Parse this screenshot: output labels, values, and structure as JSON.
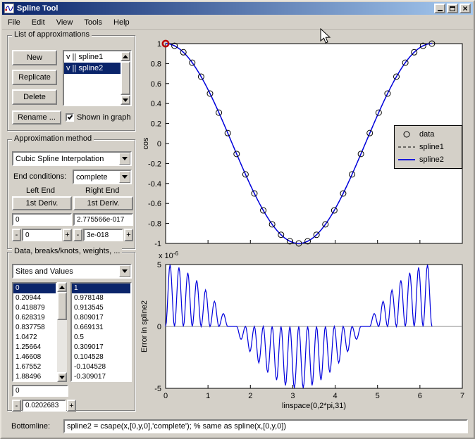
{
  "window": {
    "title": "Spline Tool",
    "controls": {
      "minimize": "minimize",
      "maximize": "maximize",
      "close_glyph": "×"
    }
  },
  "menu": [
    "File",
    "Edit",
    "View",
    "Tools",
    "Help"
  ],
  "ui": {
    "minus": "-",
    "plus": "+"
  },
  "approx_list": {
    "title": "List of approximations",
    "buttons": [
      "New",
      "Replicate",
      "Delete",
      "Rename ..."
    ],
    "items": [
      {
        "label": "v || spline1",
        "selected": false
      },
      {
        "label": "v || spline2",
        "selected": true
      }
    ],
    "checkbox_label": "Shown in graph",
    "checkbox_checked": true
  },
  "method": {
    "title": "Approximation method",
    "method_select": "Cubic Spline Interpolation",
    "end_conditions_label": "End conditions:",
    "end_conditions_value": "complete",
    "left_end_label": "Left End",
    "right_end_label": "Right End",
    "left_button": "1st Deriv.",
    "right_button": "1st Deriv.",
    "left_value": "0",
    "right_value": "2.775566e-017",
    "left_spinner_value": "0",
    "right_spinner_value": "3e-018"
  },
  "data_panel": {
    "title": "Data, breaks/knots, weights, ...",
    "select_value": "Sites and Values",
    "sites": [
      "0",
      "0.20944",
      "0.418879",
      "0.628319",
      "0.837758",
      "1.0472",
      "1.25664",
      "1.46608",
      "1.67552",
      "1.88496"
    ],
    "values": [
      "1",
      "0.978148",
      "0.913545",
      "0.809017",
      "0.669131",
      "0.5",
      "0.309017",
      "0.104528",
      "-0.104528",
      "-0.309017"
    ],
    "edit_value": "0",
    "spinner_value": "0.0202683"
  },
  "bottomline": {
    "label": "Bottomline:",
    "value": "spline2 = csape(x,[0,y,0],'complete'); % same as  spline(x,[0,y,0])"
  },
  "chart_data": [
    {
      "type": "line",
      "title": "",
      "xlabel": "",
      "ylabel": "cos",
      "xlim": [
        0,
        7
      ],
      "ylim": [
        -1,
        1
      ],
      "xticks": [
        0,
        1,
        2,
        3,
        4,
        5,
        6,
        7
      ],
      "yticks": [
        -1,
        -0.8,
        -0.6,
        -0.4,
        -0.2,
        0,
        0.2,
        0.4,
        0.6,
        0.8,
        1
      ],
      "grid": false,
      "legend": [
        "data",
        "spline1",
        "spline2"
      ],
      "legend_position": "right-center",
      "x": [
        0,
        0.20944,
        0.41888,
        0.62832,
        0.83776,
        1.0472,
        1.25664,
        1.46608,
        1.67552,
        1.88496,
        2.0944,
        2.30383,
        2.51327,
        2.72271,
        2.93215,
        3.14159,
        3.35103,
        3.56047,
        3.76991,
        3.97935,
        4.18879,
        4.39823,
        4.60767,
        4.81711,
        5.02655,
        5.23599,
        5.44543,
        5.65487,
        5.86431,
        6.07375,
        6.28319
      ],
      "series": [
        {
          "name": "data",
          "style": "scatter-circle",
          "color": "#000000",
          "values": [
            1,
            0.978148,
            0.913545,
            0.809017,
            0.669131,
            0.5,
            0.309017,
            0.104528,
            -0.104528,
            -0.309017,
            -0.5,
            -0.669131,
            -0.809017,
            -0.913545,
            -0.978148,
            -1,
            -0.978148,
            -0.913545,
            -0.809017,
            -0.669131,
            -0.5,
            -0.309017,
            -0.104528,
            0.104528,
            0.309017,
            0.5,
            0.669131,
            0.809017,
            0.913545,
            0.978148,
            1
          ]
        },
        {
          "name": "spline1",
          "style": "dashed",
          "color": "#000000",
          "note": "cubic spline through data, visually coincides with cos"
        },
        {
          "name": "spline2",
          "style": "solid",
          "color": "#0000dd",
          "note": "cubic spline through data, visually coincides with cos"
        }
      ],
      "highlight_point": {
        "index": 0,
        "color": "#bb0000"
      }
    },
    {
      "type": "line",
      "title": "",
      "xlabel": "linspace(0,2*pi,31)",
      "ylabel": "Error in spline2",
      "scale_label": "x 10^-6",
      "unit": 1e-06,
      "xlim": [
        0,
        7
      ],
      "ylim": [
        -5,
        5
      ],
      "xticks": [
        0,
        1,
        2,
        3,
        4,
        5,
        6,
        7
      ],
      "yticks": [
        -5,
        0,
        5
      ],
      "grid": false,
      "zero_line": true,
      "color": "#0000dd",
      "knots_x": [
        0,
        0.20944,
        0.41888,
        0.62832,
        0.83776,
        1.0472,
        1.25664,
        1.46608,
        1.67552,
        1.88496,
        2.0944,
        2.30383,
        2.51327,
        2.72271,
        2.93215,
        3.14159,
        3.35103,
        3.56047,
        3.76991,
        3.97935,
        4.18879,
        4.39823,
        4.60767,
        4.81711,
        5.02655,
        5.23599,
        5.44543,
        5.65487,
        5.86431,
        6.07375,
        6.28319
      ],
      "interval_peaks": [
        4.97,
        4.76,
        4.33,
        3.72,
        2.94,
        2.03,
        1.04,
        0,
        -1.04,
        -2.03,
        -2.94,
        -3.72,
        -4.33,
        -4.76,
        -4.97,
        -4.97,
        -4.76,
        -4.33,
        -3.72,
        -2.94,
        -2.03,
        -1.04,
        0,
        1.04,
        2.03,
        2.94,
        3.72,
        4.33,
        4.76,
        4.97
      ]
    }
  ]
}
